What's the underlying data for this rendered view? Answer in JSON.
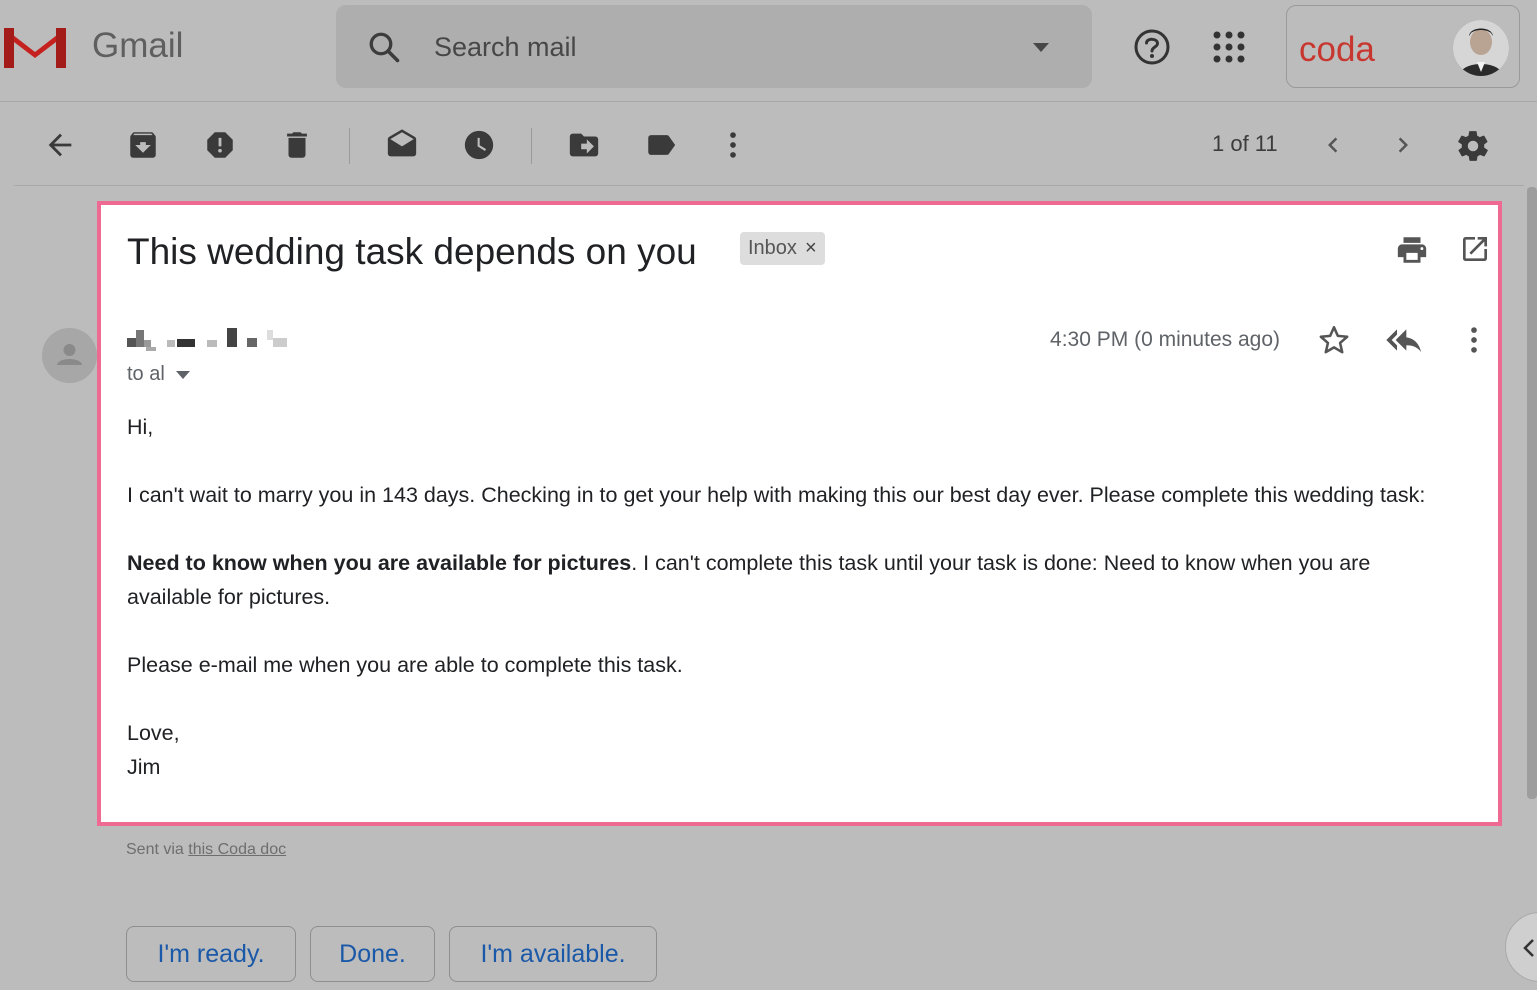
{
  "header": {
    "app_name": "Gmail",
    "search_placeholder": "Search mail",
    "account_brand": "coda"
  },
  "toolbar": {
    "pager": "1 of 11"
  },
  "email": {
    "subject": "This wedding task depends on you",
    "label_chip": "Inbox",
    "chip_close": "×",
    "recipient": "to al",
    "timestamp": "4:30 PM (0 minutes ago)",
    "greeting": "Hi,",
    "paragraph1": "I can't wait to marry you in 143 days. Checking in to get your help with making this our best day ever. Please complete this wedding task:",
    "task_bold": "Need to know when you are available for pictures",
    "task_rest": ". I can't complete this task until your task is done: Need to know when you are available for pictures.",
    "paragraph3": "Please e-mail me when you are able to complete this task.",
    "signoff": "Love,",
    "signature": "Jim"
  },
  "footer": {
    "sent_via_prefix": "Sent via ",
    "sent_via_link": "this Coda doc"
  },
  "smart_replies": [
    "I'm ready.",
    "Done.",
    "I'm available."
  ],
  "colors": {
    "highlight_border": "#ef6a92",
    "gmail_red": "#d93025",
    "coda_red": "#c8372f",
    "link_blue": "#1a58a8"
  }
}
